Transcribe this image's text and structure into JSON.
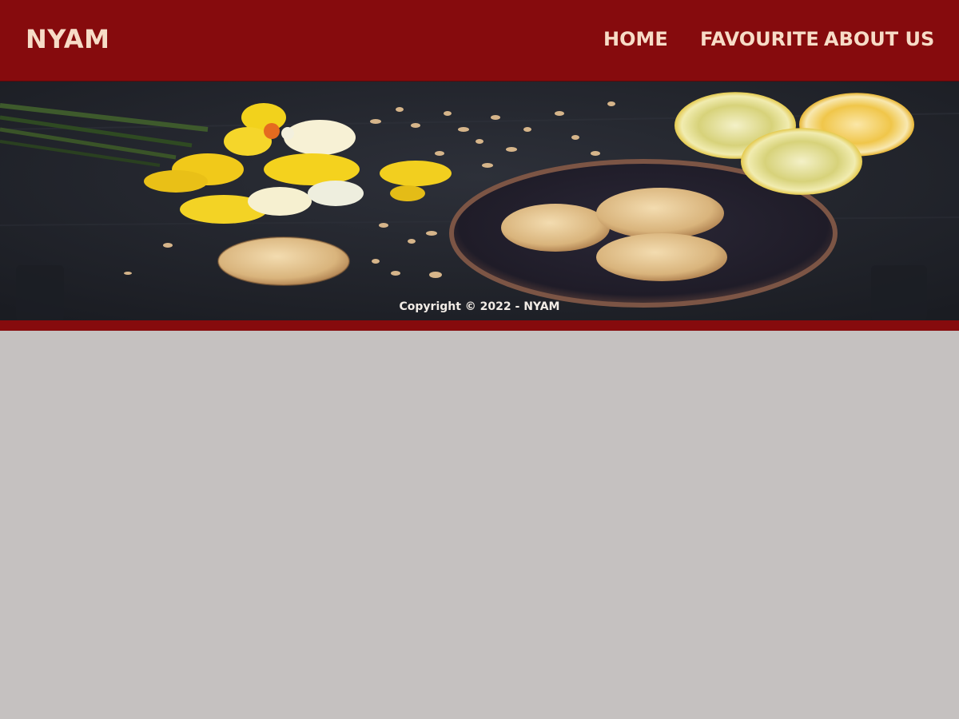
{
  "header": {
    "brand": "NYAM",
    "nav": [
      {
        "label": "HOME"
      },
      {
        "label": "FAVOURITE"
      },
      {
        "label": "ABOUT US"
      }
    ]
  },
  "hero": {
    "caption": "Copyright © 2022 - NYAM"
  },
  "colors": {
    "brand_red": "#860b0d",
    "nav_text": "#f7dcc7",
    "page_background": "#c5c1c0",
    "hero_background": "#24272f"
  }
}
